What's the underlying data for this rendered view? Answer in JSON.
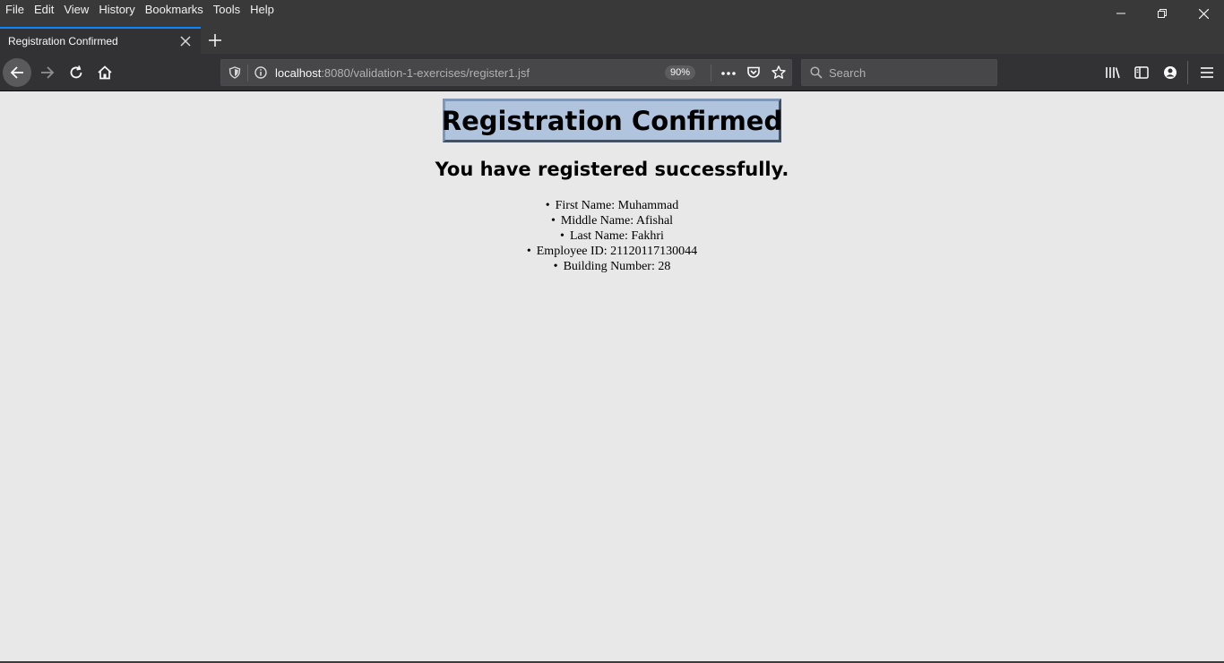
{
  "menu": [
    "File",
    "Edit",
    "View",
    "History",
    "Bookmarks",
    "Tools",
    "Help"
  ],
  "tab": {
    "title": "Registration Confirmed"
  },
  "urlbar": {
    "host": "localhost",
    "path": ":8080/validation-1-exercises/register1.jsf",
    "zoom": "90%"
  },
  "search": {
    "placeholder": "Search"
  },
  "page": {
    "title": "Registration Confirmed",
    "subtitle": "You have registered successfully.",
    "details": [
      "First Name: Muhammad",
      "Middle Name: Afishal",
      "Last Name: Fakhri",
      "Employee ID: 21120117130044",
      "Building Number: 28"
    ]
  },
  "colors": {
    "chrome_dark": "#393939",
    "toolbar": "#323234",
    "accent": "#0a84ff",
    "title_box": "#b0c4de",
    "page_bg": "#e8e8e8"
  }
}
